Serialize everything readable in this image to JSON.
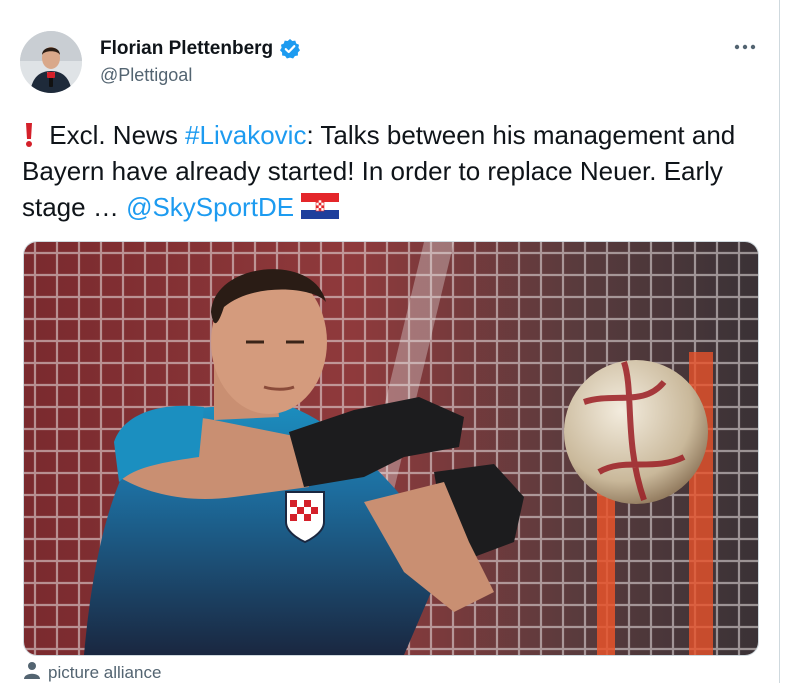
{
  "author": {
    "display_name": "Florian Plettenberg",
    "handle": "@Plettigoal",
    "verified_icon": "verified-badge-icon"
  },
  "tweet": {
    "emoji_icon": "exclamation-icon",
    "text_part1": "Excl. News ",
    "hashtag": "#Livakovic",
    "text_part2": ": Talks between his management and Bayern have already started! In order to replace Neuer. Early stage … ",
    "mention": "@SkySportDE",
    "flag_icon": "croatia-flag-icon"
  },
  "media": {
    "description_icon": "goalkeeper-photo"
  },
  "credit": {
    "icon": "person-icon",
    "text": "picture alliance"
  },
  "colors": {
    "link": "#1d9bf0",
    "text": "#0f1419",
    "secondary": "#536471",
    "verified": "#1d9bf0"
  }
}
